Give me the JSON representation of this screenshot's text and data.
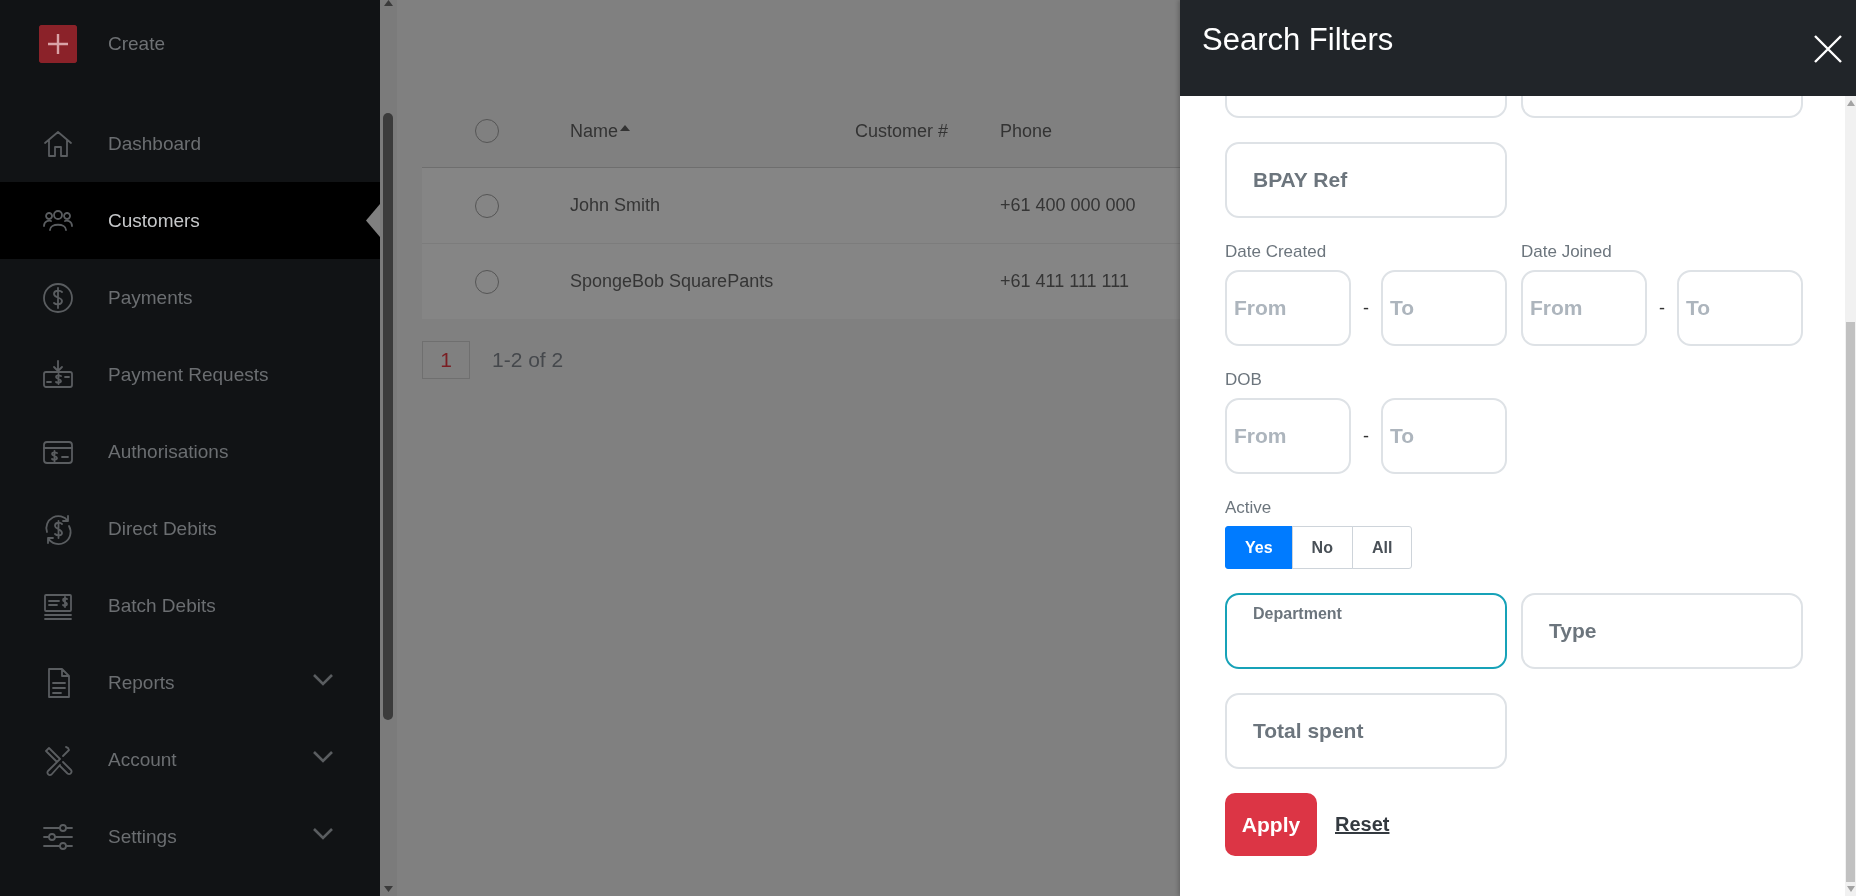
{
  "sidebar": {
    "create": {
      "label": "Create"
    },
    "items": [
      {
        "label": "Dashboard",
        "selected": false,
        "expandable": false
      },
      {
        "label": "Customers",
        "selected": true,
        "expandable": false
      },
      {
        "label": "Payments",
        "selected": false,
        "expandable": false
      },
      {
        "label": "Payment Requests",
        "selected": false,
        "expandable": false
      },
      {
        "label": "Authorisations",
        "selected": false,
        "expandable": false
      },
      {
        "label": "Direct Debits",
        "selected": false,
        "expandable": false
      },
      {
        "label": "Batch Debits",
        "selected": false,
        "expandable": false
      },
      {
        "label": "Reports",
        "selected": false,
        "expandable": true
      },
      {
        "label": "Account",
        "selected": false,
        "expandable": true
      },
      {
        "label": "Settings",
        "selected": false,
        "expandable": true
      }
    ]
  },
  "table": {
    "select_all": {
      "checked": false
    },
    "columns": [
      {
        "label": "Name",
        "sorted": true
      },
      {
        "label": "Customer #",
        "sorted": false
      },
      {
        "label": "Phone",
        "sorted": false
      }
    ],
    "rows": [
      {
        "name": "John Smith",
        "phone": "+61 400 000 000",
        "checked": false
      },
      {
        "name": "SpongeBob SquarePants",
        "phone": "+61 411 111 111",
        "checked": false
      }
    ]
  },
  "pagination": {
    "pages": [
      {
        "label": "1",
        "selected": true
      }
    ],
    "summary": "1-2 of 2"
  },
  "filter_panel": {
    "title": "Search Filters",
    "rows": [
      [
        {
          "kind": "text",
          "label": "BPAY Ref",
          "focused": false
        }
      ],
      [
        {
          "kind": "range",
          "label": "Date Created",
          "from": {
            "placeholder": "From"
          },
          "separator": "-",
          "to": {
            "placeholder": "To"
          }
        },
        {
          "kind": "range",
          "label": "Date Joined",
          "from": {
            "placeholder": "From"
          },
          "separator": "-",
          "to": {
            "placeholder": "To"
          }
        }
      ],
      [
        {
          "kind": "range",
          "label": "DOB",
          "from": {
            "placeholder": "From"
          },
          "separator": "-",
          "to": {
            "placeholder": "To"
          }
        }
      ],
      [
        {
          "kind": "toggle",
          "label": "Active",
          "options": [
            {
              "label": "Yes",
              "selected": true
            },
            {
              "label": "No",
              "selected": false
            },
            {
              "label": "All",
              "selected": false
            }
          ]
        }
      ],
      [
        {
          "kind": "text",
          "label": "Department",
          "focused": true
        },
        {
          "kind": "text",
          "label": "Type",
          "focused": false
        }
      ],
      [
        {
          "kind": "text",
          "label": "Total spent",
          "focused": false
        }
      ]
    ],
    "actions": [
      {
        "kind": "primary",
        "label": "Apply"
      },
      {
        "kind": "link",
        "label": "Reset"
      }
    ]
  }
}
